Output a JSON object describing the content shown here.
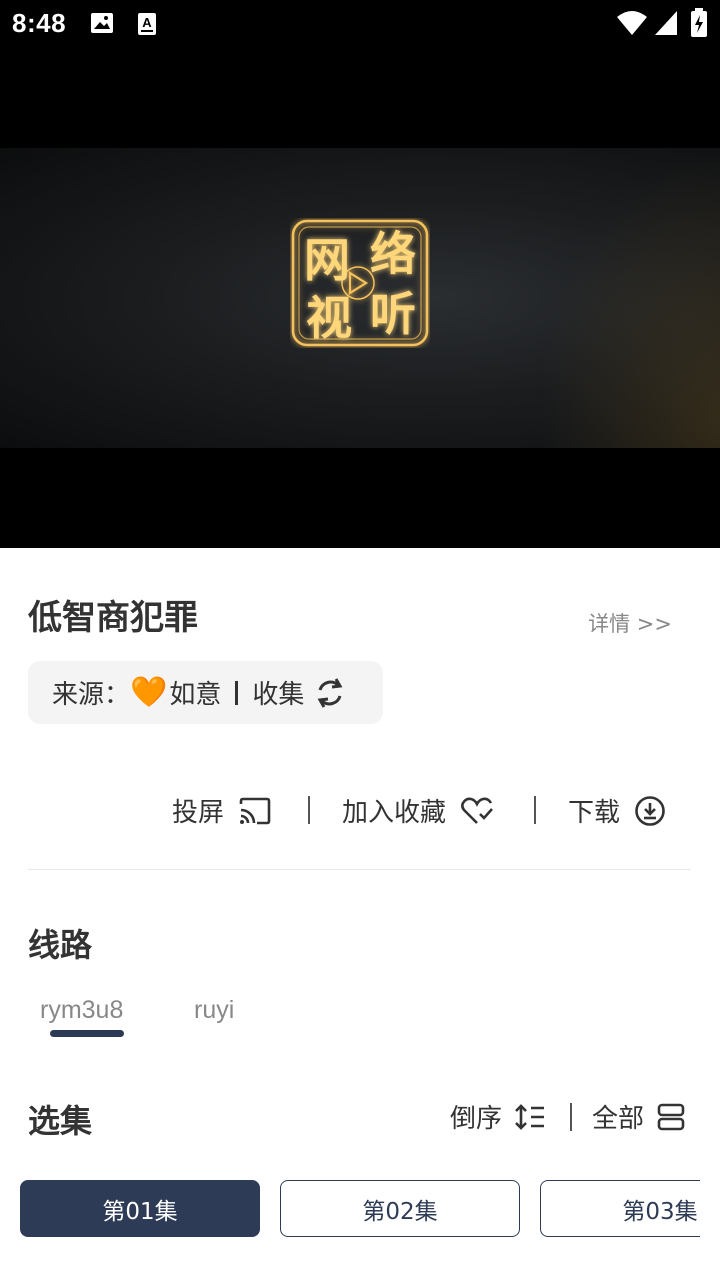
{
  "status_bar": {
    "time": "8:48",
    "icons": [
      "image-icon",
      "text-a-icon",
      "wifi-icon",
      "signal-icon",
      "battery-icon"
    ]
  },
  "video": {
    "logo_text": [
      "网",
      "络",
      "视",
      "听"
    ],
    "accent": "#f6c15a"
  },
  "show": {
    "title": "低智商犯罪",
    "detail_link": "详情 >>"
  },
  "source": {
    "label": "来源：",
    "heart": "🧡",
    "name": "如意",
    "action": "收集"
  },
  "actions": {
    "cast": "投屏",
    "favorite": "加入收藏",
    "download": "下载"
  },
  "routes": {
    "title": "线路",
    "items": [
      "rym3u8",
      "ruyi"
    ],
    "active_index": 0
  },
  "episodes": {
    "title": "选集",
    "sort_label": "倒序",
    "all_label": "全部",
    "items": [
      "第01集",
      "第02集",
      "第03集"
    ],
    "active_index": 0
  },
  "colors": {
    "primary": "#2e3b56",
    "heart": "#f5820a",
    "muted": "#888888"
  }
}
